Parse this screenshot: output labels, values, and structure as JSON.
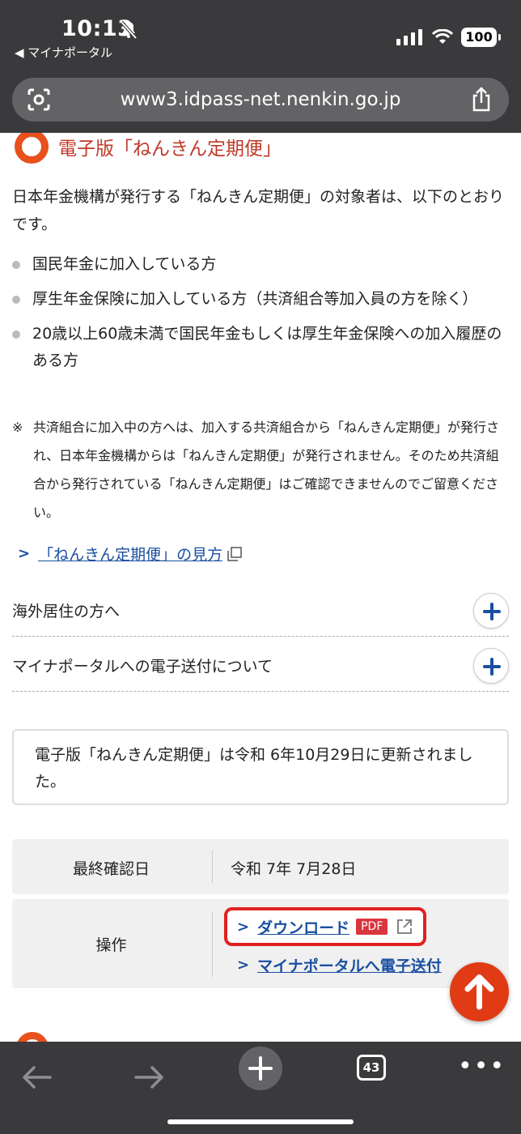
{
  "status_bar": {
    "time": "10:13",
    "back_app": "◀ マイナポータル",
    "battery": "100"
  },
  "browser": {
    "url": "www3.idpass-net.nenkin.go.jp",
    "tabs_count": "43"
  },
  "section": {
    "heading": "電子版「ねんきん定期便」",
    "intro": "日本年金機構が発行する「ねんきん定期便」の対象者は、以下のとおりです。",
    "bullets": [
      "国民年金に加入している方",
      "厚生年金保険に加入している方（共済組合等加入員の方を除く）",
      "20歳以上60歳未満で国民年金もしくは厚生年金保険への加入履歴のある方"
    ],
    "note_mark": "※",
    "note": "共済組合に加入中の方へは、加入する共済組合から「ねんきん定期便」が発行され、日本年金機構からは「ねんきん定期便」が発行されません。そのため共済組合から発行されている「ねんきん定期便」はご確認できませんのでご留意ください。",
    "link": "「ねんきん定期便」の見方"
  },
  "accordions": [
    {
      "label": "海外居住の方へ"
    },
    {
      "label": "マイナポータルへの電子送付について"
    }
  ],
  "update_notice": "電子版「ねんきん定期便」は令和 6年10月29日に更新されました。",
  "table": {
    "last_checked_label": "最終確認日",
    "last_checked_value": "令和 7年 7月28日",
    "operation_label": "操作",
    "download_label": "ダウンロード",
    "pdf_badge": "PDF",
    "send_label": "マイナポータルへ電子送付"
  },
  "colors": {
    "accent_red": "#e8501c",
    "link_blue": "#1a4fa0",
    "highlight_red": "#e02020"
  }
}
